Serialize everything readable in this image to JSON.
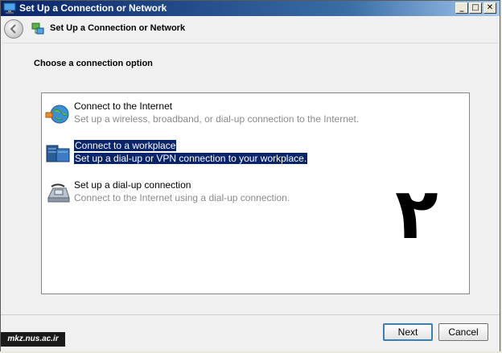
{
  "window": {
    "title": "Set Up a Connection or Network",
    "controls": {
      "minimize": "_",
      "maximize": "□",
      "close": "✕"
    }
  },
  "nav": {
    "title": "Set Up a Connection or Network",
    "back_icon": "back-arrow-icon",
    "wizard_icon": "network-wizard-icon"
  },
  "content": {
    "heading": "Choose a connection option",
    "options": [
      {
        "title": "Connect to the Internet",
        "description": "Set up a wireless, broadband, or dial-up connection to the Internet.",
        "icon": "globe-internet-icon",
        "selected": false
      },
      {
        "title": "Connect to a workplace",
        "description": "Set up a dial-up or VPN connection to your workplace.",
        "icon": "workplace-server-icon",
        "selected": true
      },
      {
        "title": "Set up a dial-up connection",
        "description": "Connect to the Internet using a dial-up connection.",
        "icon": "telephone-modem-icon",
        "selected": false
      }
    ],
    "overlay_char": "۲"
  },
  "footer": {
    "next_label": "Next",
    "cancel_label": "Cancel",
    "watermark": "mkz.nus.ac.ir"
  },
  "colors": {
    "selection": "#0a246a",
    "accent": "#3c7fb1",
    "titlebar_start": "#0a246a"
  }
}
